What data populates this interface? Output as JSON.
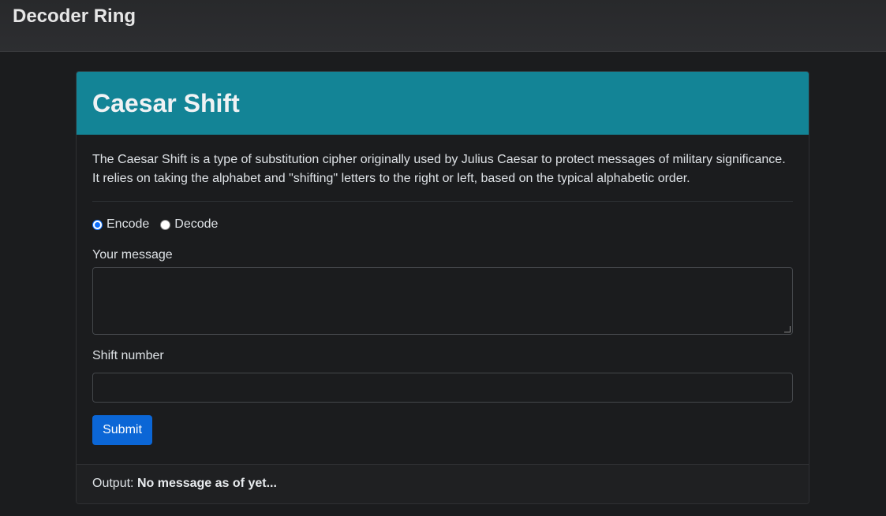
{
  "navbar": {
    "brand": "Decoder Ring"
  },
  "card": {
    "title": "Caesar Shift",
    "description": "The Caesar Shift is a type of substitution cipher originally used by Julius Caesar to protect messages of military significance. It relies on taking the alphabet and \"shifting\" letters to the right or left, based on the typical alphabetic order.",
    "mode": {
      "options": [
        "Encode",
        "Decode"
      ],
      "selected": "Encode"
    },
    "message": {
      "label": "Your message",
      "value": ""
    },
    "shift": {
      "label": "Shift number",
      "value": ""
    },
    "submit_label": "Submit",
    "output": {
      "label": "Output:",
      "value": "No message as of yet..."
    }
  },
  "colors": {
    "header_bg": "#138496",
    "button_bg": "#0b66d6",
    "page_bg": "#1b1c1e"
  }
}
